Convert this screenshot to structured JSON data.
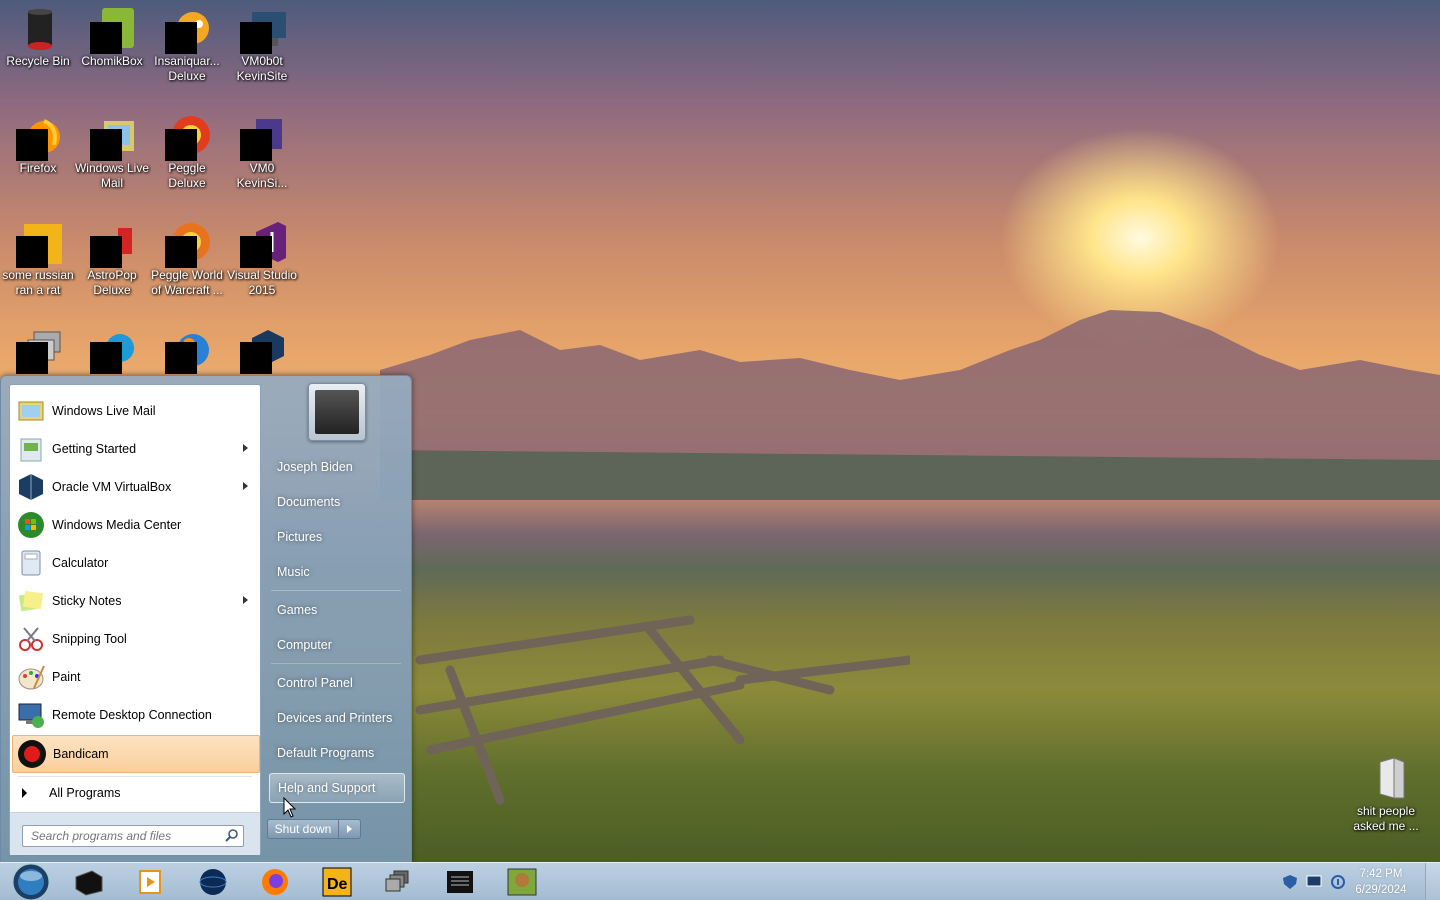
{
  "desktop_icons": [
    {
      "label": "Recycle Bin",
      "icon": "recycle-bin-icon"
    },
    {
      "label": "ChomikBox",
      "icon": "chomikbox-icon"
    },
    {
      "label": "Insaniquar... Deluxe",
      "icon": "insaniquarium-icon"
    },
    {
      "label": "VM0b0t KevinSite",
      "icon": "vm-shortcut-icon"
    },
    {
      "label": "Firefox",
      "icon": "firefox-icon"
    },
    {
      "label": "Windows Live Mail",
      "icon": "mail-icon"
    },
    {
      "label": "Peggle Deluxe",
      "icon": "peggle-icon"
    },
    {
      "label": "VM0 KevinSi...",
      "icon": "vm-shortcut-icon"
    },
    {
      "label": "some russian ran a rat",
      "icon": "de-icon"
    },
    {
      "label": "AstroPop Deluxe",
      "icon": "astropop-icon"
    },
    {
      "label": "Peggle World of Warcraft ...",
      "icon": "peggle-icon"
    },
    {
      "label": "Visual Studio 2015",
      "icon": "visual-studio-icon"
    },
    {
      "label": "shit people asked me ...",
      "icon": "folder-icon"
    }
  ],
  "start_menu": {
    "pinned": [
      {
        "label": "Windows Live Mail",
        "icon": "mail-icon",
        "submenu": false
      },
      {
        "label": "Getting Started",
        "icon": "getting-started-icon",
        "submenu": true
      },
      {
        "label": "Oracle VM VirtualBox",
        "icon": "virtualbox-icon",
        "submenu": true
      },
      {
        "label": "Windows Media Center",
        "icon": "media-center-icon",
        "submenu": false
      },
      {
        "label": "Calculator",
        "icon": "calculator-icon",
        "submenu": false
      },
      {
        "label": "Sticky Notes",
        "icon": "sticky-notes-icon",
        "submenu": true
      },
      {
        "label": "Snipping Tool",
        "icon": "scissors-icon",
        "submenu": false
      },
      {
        "label": "Paint",
        "icon": "paint-icon",
        "submenu": false
      },
      {
        "label": "Remote Desktop Connection",
        "icon": "remote-desktop-icon",
        "submenu": false
      },
      {
        "label": "Bandicam",
        "icon": "record-icon",
        "submenu": false,
        "selected": true
      }
    ],
    "all_programs": "All Programs",
    "search_placeholder": "Search programs and files",
    "right_items": [
      {
        "label": "Joseph Biden"
      },
      {
        "label": "Documents"
      },
      {
        "label": "Pictures"
      },
      {
        "label": "Music"
      },
      {
        "label": "Games"
      },
      {
        "label": "Computer"
      },
      {
        "label": "Control Panel"
      },
      {
        "label": "Devices and Printers"
      },
      {
        "label": "Default Programs"
      },
      {
        "label": "Help and Support",
        "hover": true
      }
    ],
    "shutdown_label": "Shut down"
  },
  "taskbar": {
    "apps": [
      "black-box-icon",
      "media-player-icon",
      "globe-icon",
      "firefox-icon",
      "de-icon",
      "windows-stack-icon",
      "terminal-icon",
      "chomikbox-icon"
    ],
    "tray_icons": [
      "shield-icon",
      "monitor-icon",
      "network-icon"
    ],
    "clock_time": "7:42 PM",
    "clock_date": "6/29/2024"
  }
}
